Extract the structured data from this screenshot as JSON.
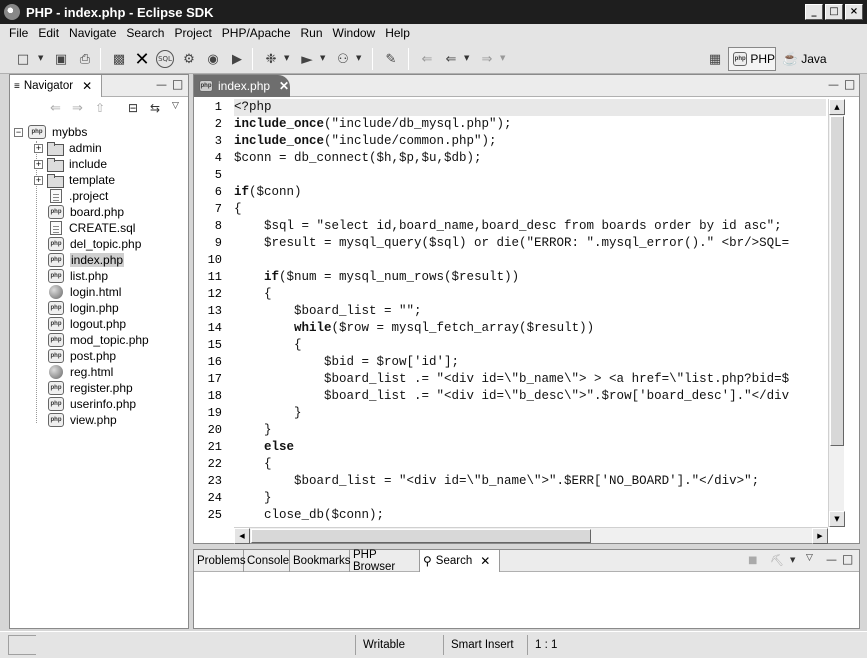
{
  "window": {
    "title": "PHP - index.php - Eclipse SDK",
    "buttons": [
      "_",
      "□",
      "×"
    ]
  },
  "menu": [
    "File",
    "Edit",
    "Navigate",
    "Search",
    "Project",
    "PHP/Apache",
    "Run",
    "Window",
    "Help"
  ],
  "perspectives": {
    "php_label": "PHP",
    "java_label": "Java"
  },
  "navigator": {
    "tab_label": "Navigator",
    "project": "mybbs",
    "folders": [
      "admin",
      "include",
      "template"
    ],
    "files": [
      {
        "name": ".project",
        "type": "file"
      },
      {
        "name": "board.php",
        "type": "php"
      },
      {
        "name": "CREATE.sql",
        "type": "file"
      },
      {
        "name": "del_topic.php",
        "type": "php"
      },
      {
        "name": "index.php",
        "type": "php",
        "selected": true
      },
      {
        "name": "list.php",
        "type": "php"
      },
      {
        "name": "login.html",
        "type": "html"
      },
      {
        "name": "login.php",
        "type": "php"
      },
      {
        "name": "logout.php",
        "type": "php"
      },
      {
        "name": "mod_topic.php",
        "type": "php"
      },
      {
        "name": "post.php",
        "type": "php"
      },
      {
        "name": "reg.html",
        "type": "html"
      },
      {
        "name": "register.php",
        "type": "php"
      },
      {
        "name": "userinfo.php",
        "type": "php"
      },
      {
        "name": "view.php",
        "type": "php"
      }
    ]
  },
  "editor": {
    "tab_label": "index.php",
    "current_line": 1,
    "lines": [
      "<?php",
      "include_once(\"include/db_mysql.php\");",
      "include_once(\"include/common.php\");",
      "$conn = db_connect($h,$p,$u,$db);",
      "",
      "if($conn)",
      "{",
      "    $sql = \"select id,board_name,board_desc from boards order by id asc\";",
      "    $result = mysql_query($sql) or die(\"ERROR: \".mysql_error().\" <br/>SQL=",
      "",
      "    if($num = mysql_num_rows($result))",
      "    {",
      "        $board_list = \"\";",
      "        while($row = mysql_fetch_array($result))",
      "        {",
      "            $bid = $row['id'];",
      "            $board_list .= \"<div id=\\\"b_name\\\"> > <a href=\\\"list.php?bid=$",
      "            $board_list .= \"<div id=\\\"b_desc\\\">\".$row['board_desc'].\"</div",
      "        }",
      "    }",
      "    else",
      "    {",
      "        $board_list = \"<div id=\\\"b_name\\\">\".$ERR['NO_BOARD'].\"</div>\";",
      "    }",
      "    close_db($conn);"
    ]
  },
  "bottom_panel": {
    "tabs": [
      "Problems",
      "Console",
      "Bookmarks",
      "PHP Browser",
      "Search"
    ],
    "active_tab": "Search"
  },
  "statusbar": {
    "mode": "Writable",
    "insert": "Smart Insert",
    "position": "1 : 1"
  }
}
